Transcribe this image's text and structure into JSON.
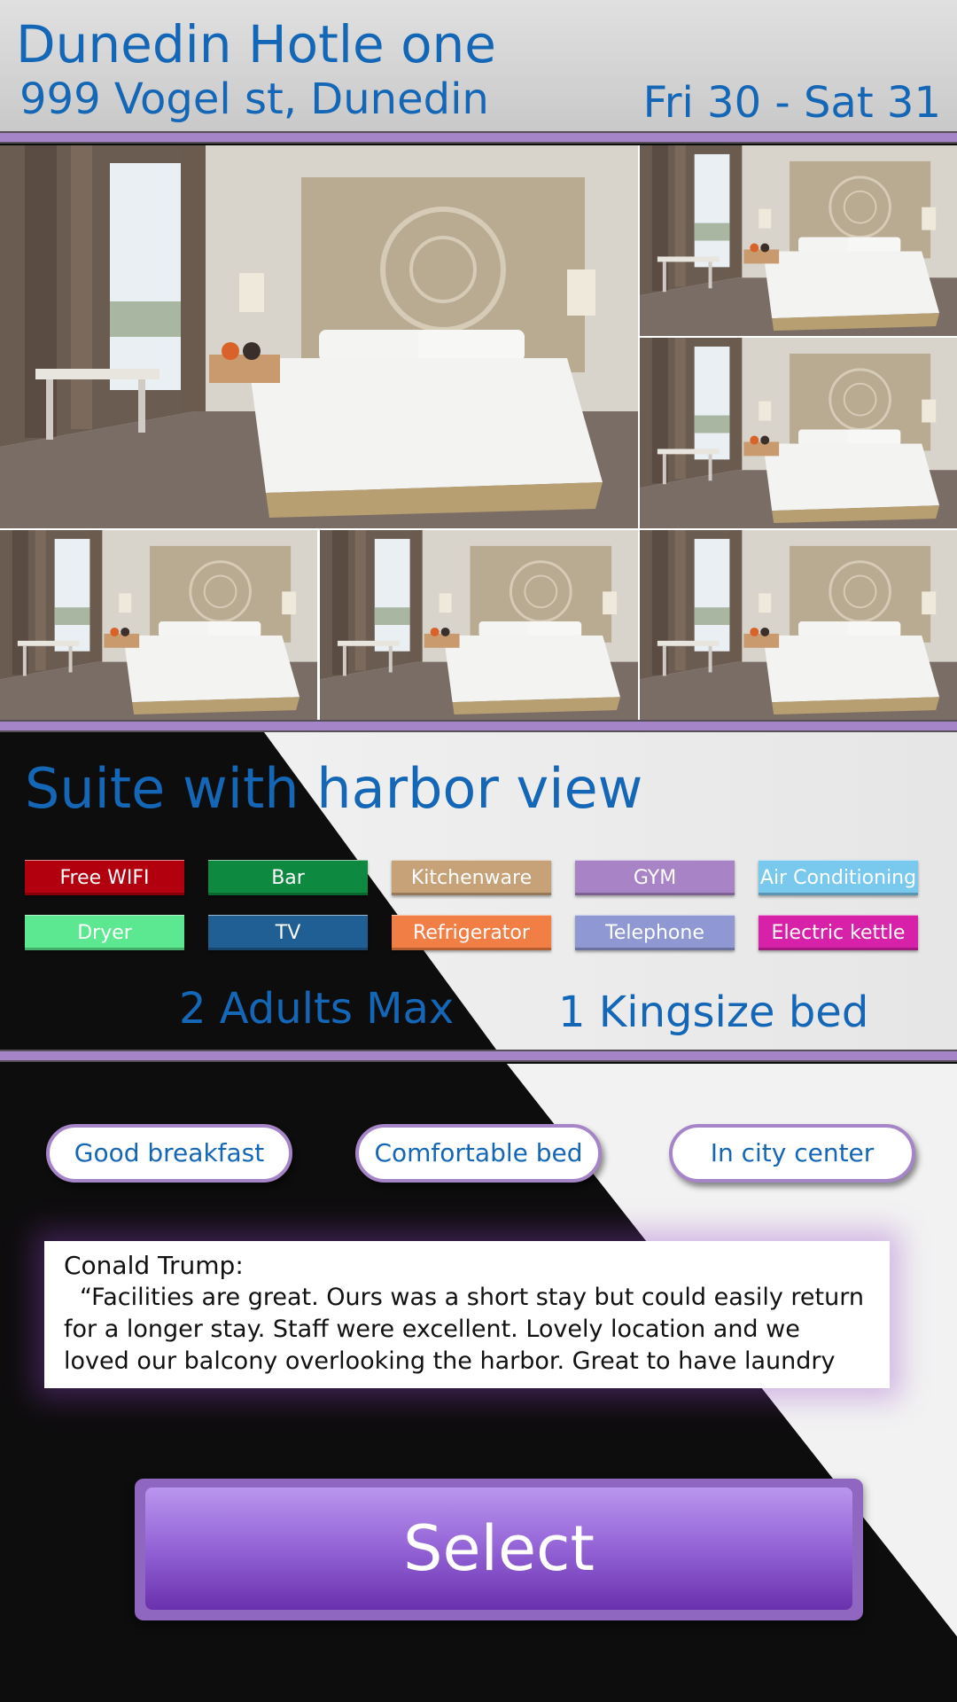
{
  "header": {
    "hotel_name": "Dunedin Hotle one",
    "address": "999 Vogel st, Dunedin",
    "dates": "Fri 30 - Sat 31"
  },
  "gallery": {
    "photo_count": 6,
    "photo_subject": "hotel-room-photo"
  },
  "room": {
    "title": "Suite with harbor view",
    "amenities": [
      {
        "label": "Free WIFI",
        "color": "#b2000f"
      },
      {
        "label": "Bar",
        "color": "#0e8a40"
      },
      {
        "label": "Kitchenware",
        "color": "#c7a278"
      },
      {
        "label": "GYM",
        "color": "#a883c6"
      },
      {
        "label": "Air Conditioning",
        "color": "#79c9ee"
      },
      {
        "label": "Dryer",
        "color": "#5ce890"
      },
      {
        "label": "TV",
        "color": "#1f5f94"
      },
      {
        "label": "Refrigerator",
        "color": "#f07e45"
      },
      {
        "label": "Telephone",
        "color": "#8f98d2"
      },
      {
        "label": "Electric kettle",
        "color": "#d721a8"
      }
    ],
    "capacity": "2 Adults Max",
    "bed": "1 Kingsize bed"
  },
  "review_tags": [
    "Good breakfast",
    "Comfortable bed",
    "In city center"
  ],
  "review": {
    "author": "Conald Trump:",
    "text": "“Facilities are great. Ours was a short stay but could easily return for a longer stay. Staff were excellent. Lovely location and we loved our balcony overlooking the harbor. Great to have laundry"
  },
  "select_button": "Select",
  "colors": {
    "accent_blue": "#1467b6",
    "divider_purple": "#a684c8",
    "button_purple": "#9363d6"
  }
}
